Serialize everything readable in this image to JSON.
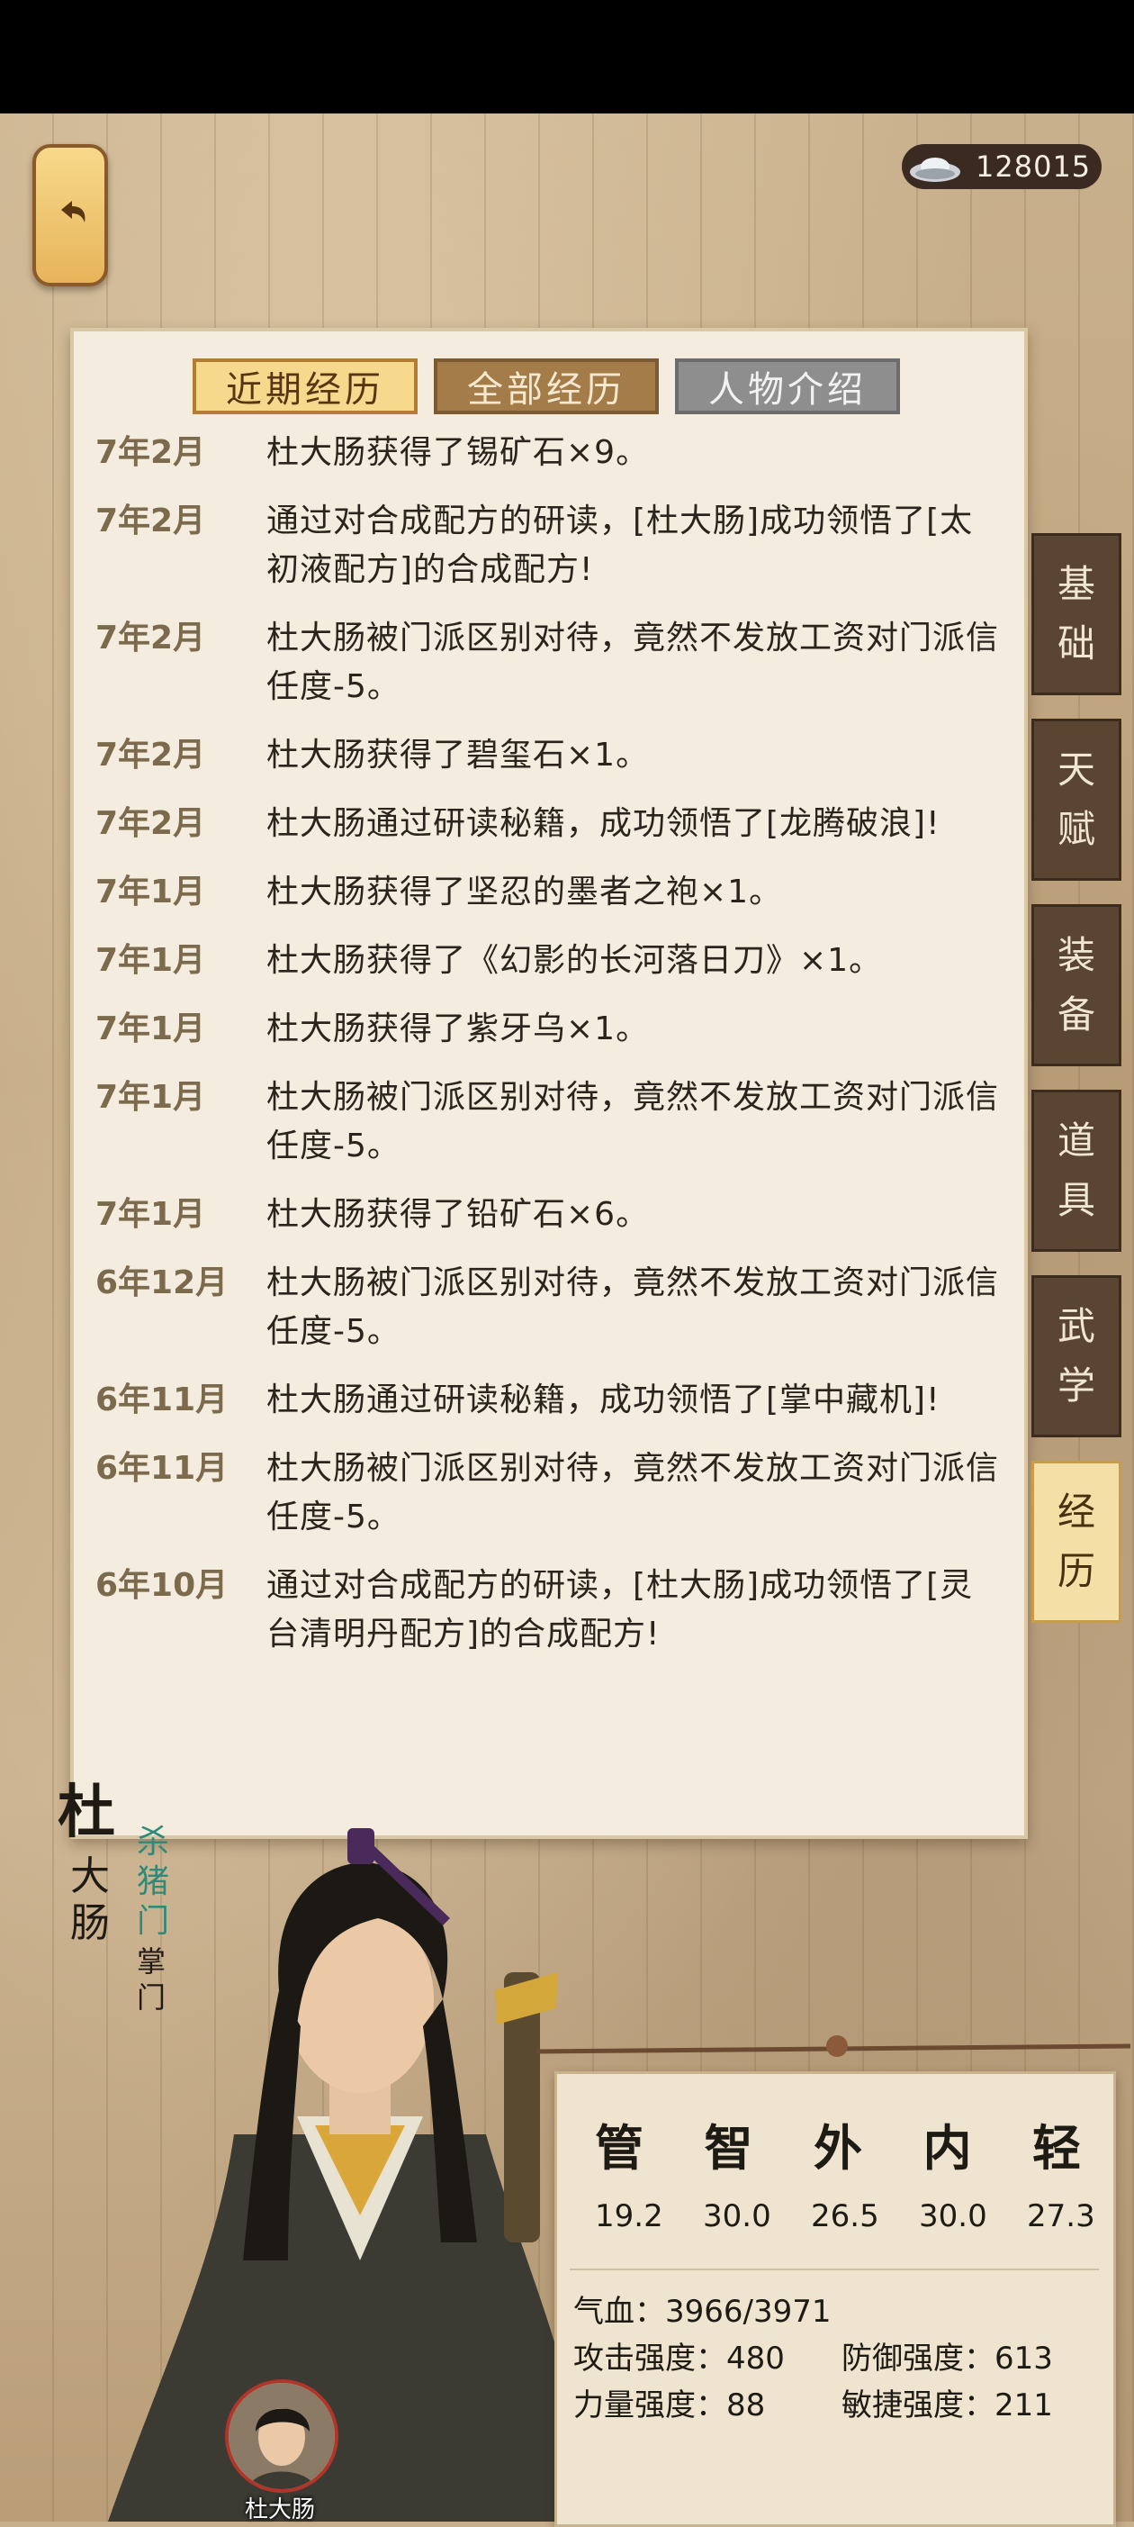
{
  "currency": {
    "amount": "128015",
    "icon": "silver-ingot-icon"
  },
  "back": {
    "icon": "return-arrow-icon"
  },
  "tabs": [
    {
      "label": "近期经历"
    },
    {
      "label": "全部经历"
    },
    {
      "label": "人物介绍"
    }
  ],
  "entries": [
    {
      "date": "7年2月",
      "text": "杜大肠获得了锡矿石×9。"
    },
    {
      "date": "7年2月",
      "text": "通过对合成配方的研读，[杜大肠]成功领悟了[太初液配方]的合成配方!"
    },
    {
      "date": "7年2月",
      "text": "杜大肠被门派区别对待，竟然不发放工资对门派信任度-5。"
    },
    {
      "date": "7年2月",
      "text": "杜大肠获得了碧玺石×1。"
    },
    {
      "date": "7年2月",
      "text": "杜大肠通过研读秘籍，成功领悟了[龙腾破浪]!"
    },
    {
      "date": "7年1月",
      "text": "杜大肠获得了坚忍的墨者之袍×1。"
    },
    {
      "date": "7年1月",
      "text": "杜大肠获得了《幻影的长河落日刀》×1。"
    },
    {
      "date": "7年1月",
      "text": "杜大肠获得了紫牙乌×1。"
    },
    {
      "date": "7年1月",
      "text": "杜大肠被门派区别对待，竟然不发放工资对门派信任度-5。"
    },
    {
      "date": "7年1月",
      "text": "杜大肠获得了铅矿石×6。"
    },
    {
      "date": "6年12月",
      "text": "杜大肠被门派区别对待，竟然不发放工资对门派信任度-5。"
    },
    {
      "date": "6年11月",
      "text": "杜大肠通过研读秘籍，成功领悟了[掌中藏机]!"
    },
    {
      "date": "6年11月",
      "text": "杜大肠被门派区别对待，竟然不发放工资对门派信任度-5。"
    },
    {
      "date": "6年10月",
      "text": "通过对合成配方的研读，[杜大肠]成功领悟了[灵台清明丹配方]的合成配方!"
    }
  ],
  "side_tabs": [
    {
      "l1": "基",
      "l2": "础"
    },
    {
      "l1": "天",
      "l2": "赋"
    },
    {
      "l1": "装",
      "l2": "备"
    },
    {
      "l1": "道",
      "l2": "具"
    },
    {
      "l1": "武",
      "l2": "学"
    },
    {
      "l1": "经",
      "l2": "历"
    }
  ],
  "character": {
    "surname": "杜",
    "given1": "大",
    "given2": "肠",
    "sect": [
      "杀",
      "猪",
      "门"
    ],
    "rank": [
      "掌",
      "门"
    ],
    "avatar_name": "杜大肠"
  },
  "stats": {
    "heads": [
      "管",
      "智",
      "外",
      "内",
      "轻"
    ],
    "values": [
      "19.2",
      "30.0",
      "26.5",
      "30.0",
      "27.3"
    ],
    "hp_label": "气血：",
    "hp_value": "3966/3971",
    "attack_label": "攻击强度：",
    "attack_value": "480",
    "defense_label": "防御强度：",
    "defense_value": "613",
    "strength_label": "力量强度：",
    "strength_value": "88",
    "agility_label": "敏捷强度：",
    "agility_value": "211"
  },
  "colors": {
    "active_tab": "#f6d98c",
    "sect_text": "#2f8a7a",
    "avatar_ring": "#b0352a"
  }
}
